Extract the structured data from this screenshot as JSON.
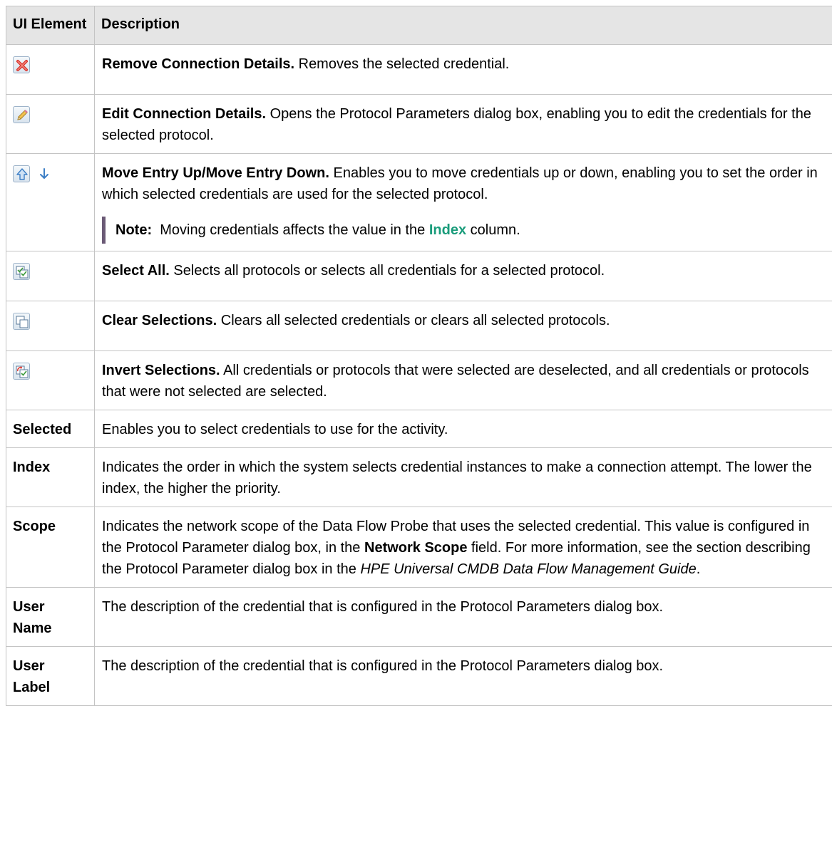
{
  "table": {
    "headers": {
      "ui_element": "UI Element",
      "description": "Description"
    },
    "rows": [
      {
        "icon": "remove-icon",
        "title": "Remove Connection Details.",
        "text": " Removes the selected credential."
      },
      {
        "icon": "edit-pencil-icon",
        "title": "Edit Connection Details.",
        "text": " Opens the Protocol Parameters dialog box, enabling you to edit the credentials for the selected protocol."
      },
      {
        "icons": [
          "move-up-icon",
          "move-down-icon"
        ],
        "title": "Move Entry Up/Move Entry Down.",
        "text": " Enables you to move credentials up or down, enabling you to set the order in which selected credentials are used for the selected protocol.",
        "note": {
          "label": "Note:",
          "text_before": "  Moving credentials affects the value in the ",
          "highlight": "Index",
          "text_after": " column."
        }
      },
      {
        "icon": "select-all-icon",
        "title": "Select All.",
        "text": " Selects all protocols or selects all credentials for a selected protocol."
      },
      {
        "icon": "clear-selections-icon",
        "title": "Clear Selections.",
        "text": " Clears all selected credentials or clears all selected protocols."
      },
      {
        "icon": "invert-selections-icon",
        "title": "Invert Selections.",
        "text": " All credentials or protocols that were selected are deselected, and all credentials or protocols that were not selected are selected."
      },
      {
        "element": "Selected",
        "description": "Enables you to select credentials to use for the activity."
      },
      {
        "element": "Index",
        "description": "Indicates the order in which the system selects credential instances to make a connection attempt. The lower the index, the higher the priority."
      },
      {
        "element": "Scope",
        "description_part1": "Indicates the network scope of the Data Flow Probe that uses the selected credential. This value is configured in the Protocol Parameter dialog box, in the ",
        "description_bold": "Network Scope",
        "description_part2": " field. For more information, see the section describing the Protocol Parameter dialog box in the ",
        "description_italic": "HPE Universal CMDB Data Flow Management Guide",
        "description_part3": "."
      },
      {
        "element": "User Name",
        "description": "The description of the credential that is configured in the Protocol Parameters dialog box."
      },
      {
        "element": "User Label",
        "description": "The description of the credential that is configured in the Protocol Parameters dialog box."
      }
    ]
  },
  "colors": {
    "header_bg": "#e5e5e5",
    "border": "#c4c4c4",
    "note_bar": "#6b5a76",
    "link_green": "#1a9c7b",
    "remove_red": "#d9302a",
    "arrow_blue": "#3d7fc6"
  }
}
